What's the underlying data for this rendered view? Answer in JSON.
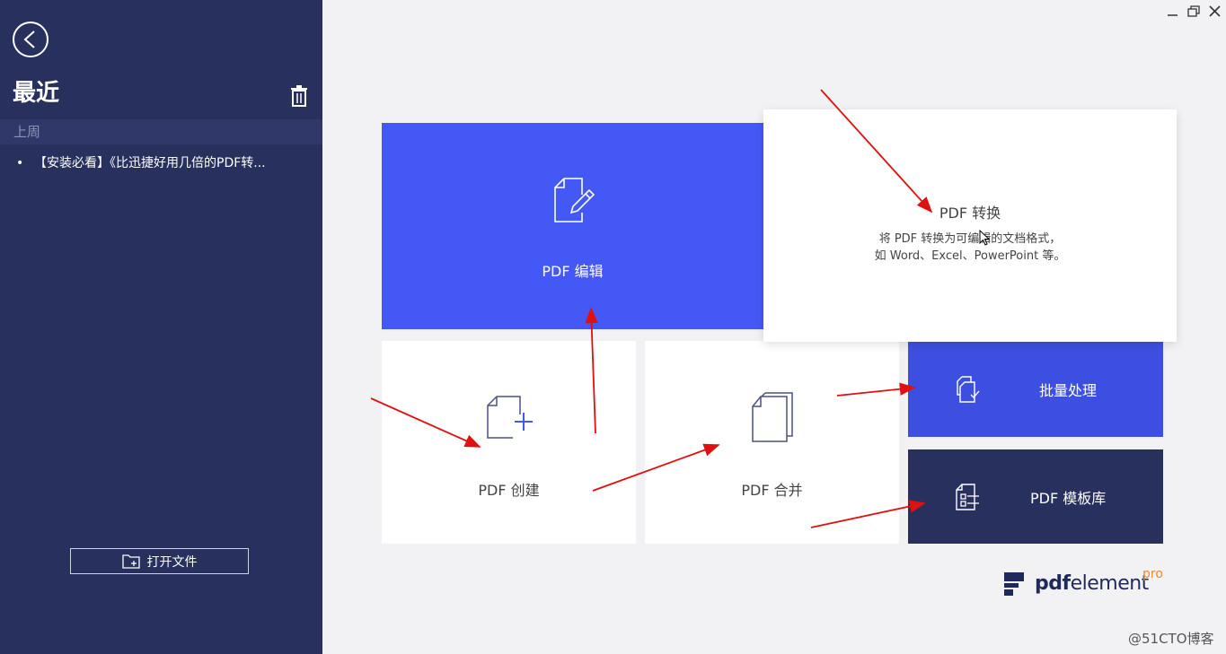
{
  "sidebar": {
    "title": "最近",
    "group_label": "上周",
    "recent_files": [
      "【安装必看】《比迅捷好用几倍的PDF转..."
    ],
    "open_button_label": "打开文件",
    "bg_color": "#28305e"
  },
  "tiles": {
    "edit": {
      "label": "PDF 编辑",
      "icon": "edit-document-icon",
      "color": "#4458f5"
    },
    "convert": {
      "title": "PDF 转换",
      "desc_line1": "将 PDF 转换为可编辑的文档格式，",
      "desc_line2": "如 Word、Excel、PowerPoint 等。"
    },
    "create": {
      "label": "PDF 创建",
      "icon": "create-document-icon"
    },
    "merge": {
      "label": "PDF 合并",
      "icon": "merge-documents-icon"
    },
    "batch": {
      "label": "批量处理",
      "icon": "batch-process-icon",
      "color": "#3d4fe0"
    },
    "template": {
      "label": "PDF 模板库",
      "icon": "template-icon",
      "color": "#28305e"
    }
  },
  "logo": {
    "bold": "pdf",
    "rest": "element",
    "pro": "pro"
  },
  "watermark": "@51CTO博客",
  "annotation_color": "#e01010"
}
